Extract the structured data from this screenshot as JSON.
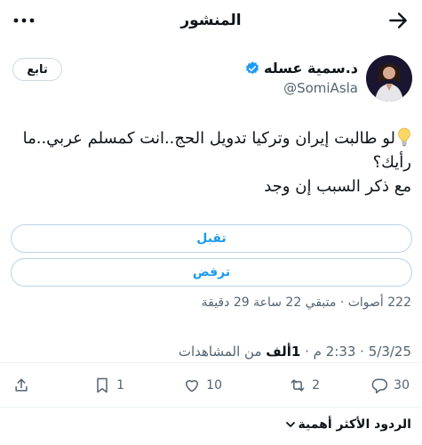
{
  "header": {
    "title": "المنشور"
  },
  "author": {
    "name": "د.سمية عسله",
    "handle": "@SomiAsla",
    "follow_label": "تابع"
  },
  "tweet": {
    "line1": "لو طالبت إيران وتركيا تدويل الحج..انت كمسلم عربي..ما رأيك؟",
    "line2": "مع ذكر السبب إن وجد"
  },
  "poll": {
    "options": [
      "تقبل",
      "ترفض"
    ],
    "meta": "222 أصوات · متبقي 22 ساعة 29 دقيقة"
  },
  "timestamp": {
    "time": "2:33 م",
    "date": "5/3/25",
    "views_count": "1ألف",
    "views_label": "من المشاهدات"
  },
  "actions": {
    "replies": "30",
    "reposts": "2",
    "likes": "10",
    "bookmarks": "1"
  },
  "replies_sort": {
    "label": "الردود الأكثر أهمية"
  },
  "colors": {
    "accent": "#1d9bf0",
    "muted": "#536471",
    "poll_border": "#b9d4ea"
  }
}
